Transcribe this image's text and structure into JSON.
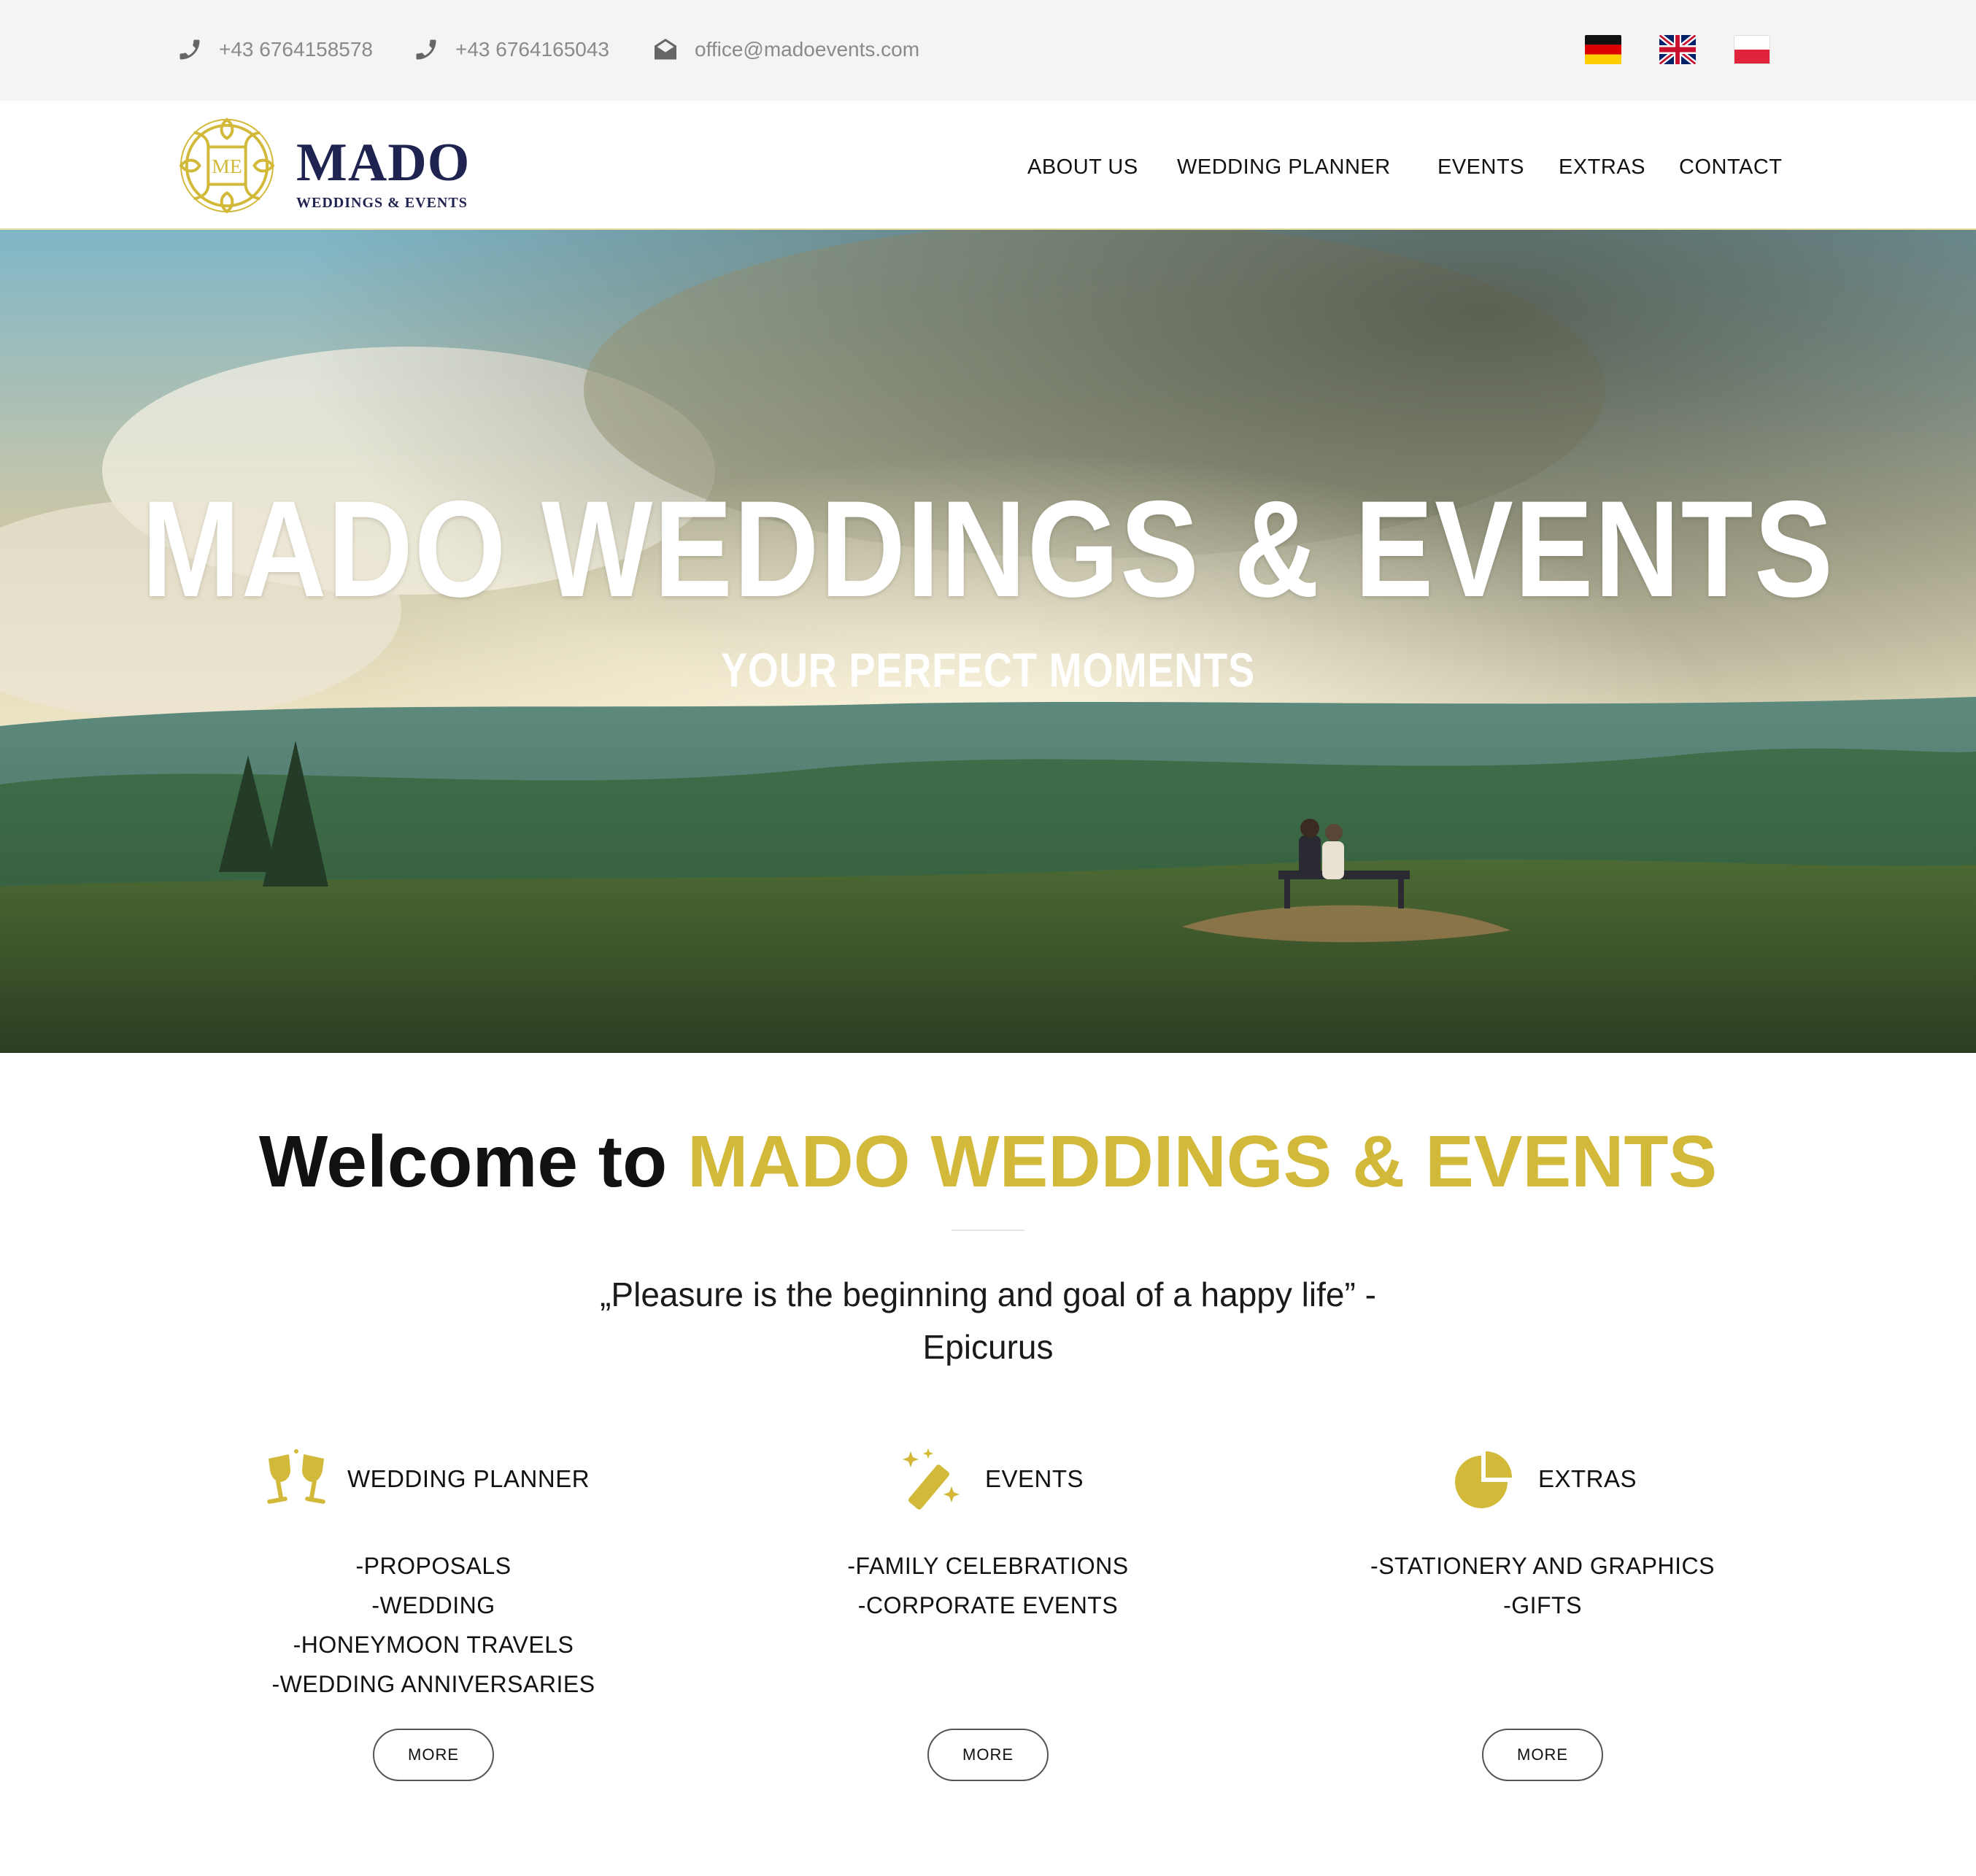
{
  "topbar": {
    "phone1": "+43 6764158578",
    "phone2": "+43 6764165043",
    "email": "office@madoevents.com",
    "icons": [
      "phone-icon",
      "phone-icon",
      "envelope-icon"
    ],
    "languages": [
      "German flag",
      "English flag",
      "Polish flag"
    ]
  },
  "header": {
    "logo_monogram": "ME",
    "logo_name": "MADO",
    "logo_tagline": "WEDDINGS & EVENTS",
    "nav": [
      "ABOUT US",
      "WEDDING PLANNER",
      "EVENTS",
      "EXTRAS",
      "CONTACT"
    ]
  },
  "hero": {
    "title": "MADO WEDDINGS & EVENTS",
    "subtitle": "YOUR PERFECT MOMENTS"
  },
  "welcome": {
    "prefix": "Welcome to",
    "brand": "MADO WEDDINGS & EVENTS",
    "quote_line1": "„Pleasure is the beginning and goal of a happy life” -",
    "quote_line2": "Epicurus"
  },
  "features": [
    {
      "icon": "champagne-glasses-icon",
      "title": "WEDDING PLANNER",
      "items": [
        "-PROPOSALS",
        "-WEDDING",
        "-HONEYMOON TRAVELS",
        "-WEDDING ANNIVERSARIES"
      ],
      "button": "MORE"
    },
    {
      "icon": "magic-wand-icon",
      "title": "EVENTS",
      "items": [
        "-FAMILY CELEBRATIONS",
        "-CORPORATE EVENTS"
      ],
      "button": "MORE"
    },
    {
      "icon": "pie-chart-icon",
      "title": "EXTRAS",
      "items": [
        "-STATIONERY AND GRAPHICS",
        "-GIFTS"
      ],
      "button": "MORE"
    }
  ],
  "colors": {
    "accent": "#d2b93a",
    "navy": "#1f2350",
    "topbar_bg": "#f4f4f4",
    "muted_text": "#8a8a8a"
  }
}
